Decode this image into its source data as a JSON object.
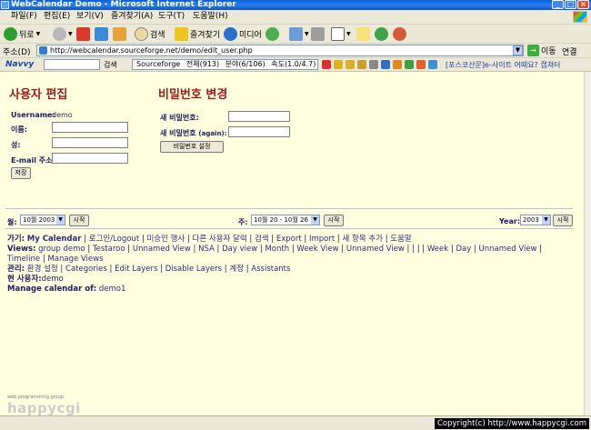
{
  "window": {
    "title": "WebCalendar Demo - Microsoft Internet Explorer"
  },
  "menubar": {
    "items": [
      "파일(F)",
      "편집(E)",
      "보기(V)",
      "즐겨찾기(A)",
      "도구(T)",
      "도움말(H)"
    ]
  },
  "toolbar": {
    "back": "뒤로",
    "search": "검색",
    "favorites": "즐겨찾기",
    "media": "미디어"
  },
  "address": {
    "label": "주소(D)",
    "url": "http://webcalendar.sourceforge.net/demo/edit_user.php",
    "go": "이동",
    "links": "연결"
  },
  "naver": {
    "logo": "Navvy",
    "search": "검색",
    "box_items": [
      "Sourceforge",
      "전체(913)",
      "분야(6/106)",
      "속도(1.0/4.7)"
    ],
    "promo": "[포스코산문]e-사이트 어때요? 캡쳐터"
  },
  "edit_user": {
    "heading": "사용자 편집",
    "username_label": "Username:",
    "username_value": "demo",
    "first_name_label": "이름:",
    "last_name_label": "성:",
    "email_label": "E-mail 주소:",
    "save_label": "저장"
  },
  "password": {
    "heading": "비밀번호 변경",
    "new_label": "새 비밀번호:",
    "again_label": "새 비밀번호",
    "again_suffix": "(again):",
    "set_label": "비밀번호 설정"
  },
  "nav": {
    "month_label": "월:",
    "month_value": "10월 2003",
    "go_label": "시작",
    "week_label": "주:",
    "week_value": "10월 20 - 10월 26",
    "year_label": "Year:",
    "year_value": "2003",
    "goto_label": "가기:",
    "goto_links": [
      "My Calendar",
      "로그인/Logout",
      "미승인 행사",
      "다른 사용자 달력",
      "검색",
      "Export",
      "Import",
      "새 항목 추가",
      "도움말"
    ],
    "views_label": "Views:",
    "views_links": [
      "group demo",
      "Testaroo",
      "Unnamed View",
      "NSA",
      "Day view",
      "Month",
      "Week View",
      "Unnamed View",
      "",
      "",
      "",
      "Week",
      "Day",
      "Unnamed View",
      "Timeline",
      "Manage Views"
    ],
    "admin_label": "관리:",
    "admin_links": [
      "환경 설정",
      "Categories",
      "Edit Layers",
      "Disable Layers",
      "계정",
      "Assistants"
    ],
    "current_user_label": "현 사용자:",
    "current_user_value": "demo",
    "manage_label": "Manage calendar of:",
    "manage_value": "demo1"
  },
  "footer": {
    "tagline": "web programming group",
    "logo_text": "happycgi"
  },
  "status": {
    "copyright": "Copyright(c) http://www.happycgi.com"
  }
}
